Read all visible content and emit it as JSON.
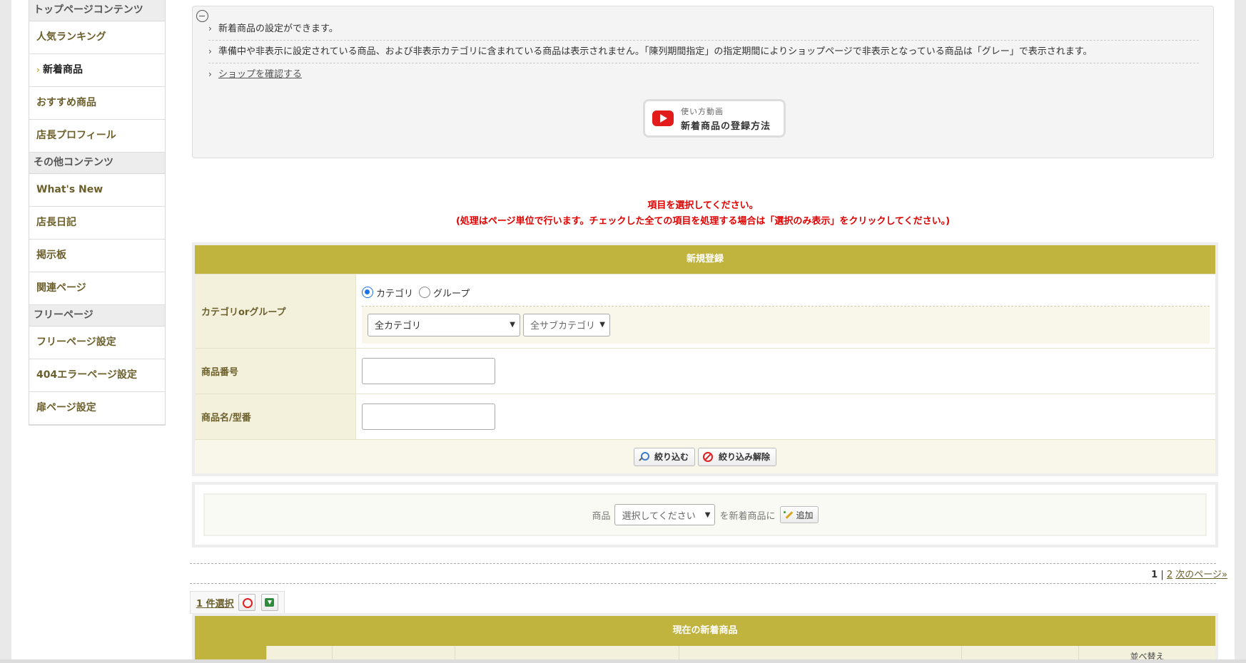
{
  "sidebar": {
    "sections": [
      {
        "heading": "トップページコンテンツ",
        "items": [
          {
            "label": "人気ランキング",
            "active": false
          },
          {
            "label": "新着商品",
            "active": true
          },
          {
            "label": "おすすめ商品",
            "active": false
          },
          {
            "label": "店長プロフィール",
            "active": false
          }
        ]
      },
      {
        "heading": "その他コンテンツ",
        "items": [
          {
            "label": "What's New",
            "active": false
          },
          {
            "label": "店長日記",
            "active": false
          },
          {
            "label": "掲示板",
            "active": false
          },
          {
            "label": "関連ページ",
            "active": false
          }
        ]
      },
      {
        "heading": "フリーページ",
        "items": [
          {
            "label": "フリーページ設定",
            "active": false
          },
          {
            "label": "404エラーページ設定",
            "active": false
          },
          {
            "label": "扉ページ設定",
            "active": false
          }
        ]
      }
    ],
    "chevron": "›"
  },
  "info": {
    "lines": [
      "新着商品の設定ができます。",
      "準備中や非表示に設定されている商品、および非表示カテゴリに含まれている商品は表示されません。「陳列期間指定」の指定期間によりショップページで非表示となっている商品は「グレー」で表示されます。"
    ],
    "link": "ショップを確認する",
    "video_sub": "使い方動画",
    "video_main": "新着商品の登録方法"
  },
  "alert": {
    "line1": "項目を選択してください。",
    "line2": "(処理はページ単位で行います。チェックした全ての項目を処理する場合は「選択のみ表示」をクリックしてください。)"
  },
  "registration": {
    "title": "新規登録",
    "category_label": "カテゴリorグループ",
    "radio_category": "カテゴリ",
    "radio_group": "グループ",
    "select_category": "全カテゴリ",
    "select_subcategory": "全サブカテゴリ",
    "product_number_label": "商品番号",
    "product_name_label": "商品名/型番",
    "filter_button": "絞り込む",
    "clear_button": "絞り込み解除"
  },
  "add_panel": {
    "prefix": "商品",
    "select_placeholder": "選択してください",
    "suffix": "を新着商品に",
    "add_button": "追加"
  },
  "pager": {
    "current": "1",
    "sep": "|",
    "page2": "2",
    "next": "次のページ»"
  },
  "selection": {
    "count": "1 件選択"
  },
  "current_table": {
    "title": "現在の新着商品",
    "sort_col": "並べ替え"
  },
  "colors": {
    "accent": "#c0b43e",
    "alert": "#e00000",
    "label_bg": "#f3f1dc"
  }
}
